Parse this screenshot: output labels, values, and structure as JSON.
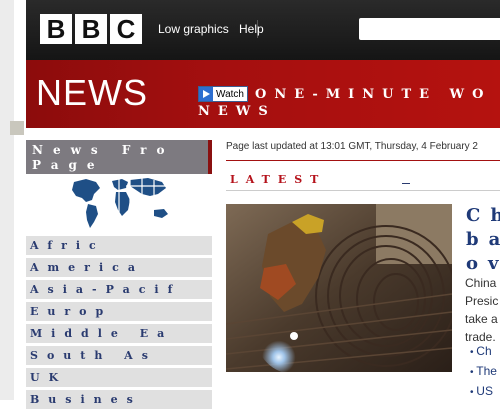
{
  "header": {
    "logo_letters": [
      "B",
      "B",
      "C"
    ],
    "links": [
      "Low graphics",
      "Help"
    ],
    "search_placeholder": ""
  },
  "banner": {
    "title": "NEWS",
    "watch_label": "Watch",
    "promo_line1": "ONE-MINUTE WO",
    "promo_line2": "NEWS"
  },
  "nav": {
    "heading_line1": "News Fro",
    "heading_line2": "Page",
    "items": [
      "Afric",
      "America",
      "Asia-Pacif",
      "Europ",
      "Middle Ea",
      "South As",
      "UK",
      "Busines"
    ]
  },
  "main": {
    "updated": "Page last updated at 13:01 GMT, Thursday, 4 February 2",
    "latest_label": "LATEST",
    "story": {
      "headline_lines": [
        "Ch",
        "ba",
        "ov"
      ],
      "summary_lines": [
        "China",
        "Presic",
        "take a",
        "trade."
      ],
      "related": [
        "Ch",
        "The",
        "US"
      ]
    }
  },
  "colors": {
    "top_bar": "#1c1c1c",
    "news_red": "#a40f0f",
    "nav_heading_bg": "#7d7a80",
    "nav_item_bg": "#e0e0e0",
    "link_blue": "#1f3a78",
    "latest_red": "#b5121b"
  }
}
